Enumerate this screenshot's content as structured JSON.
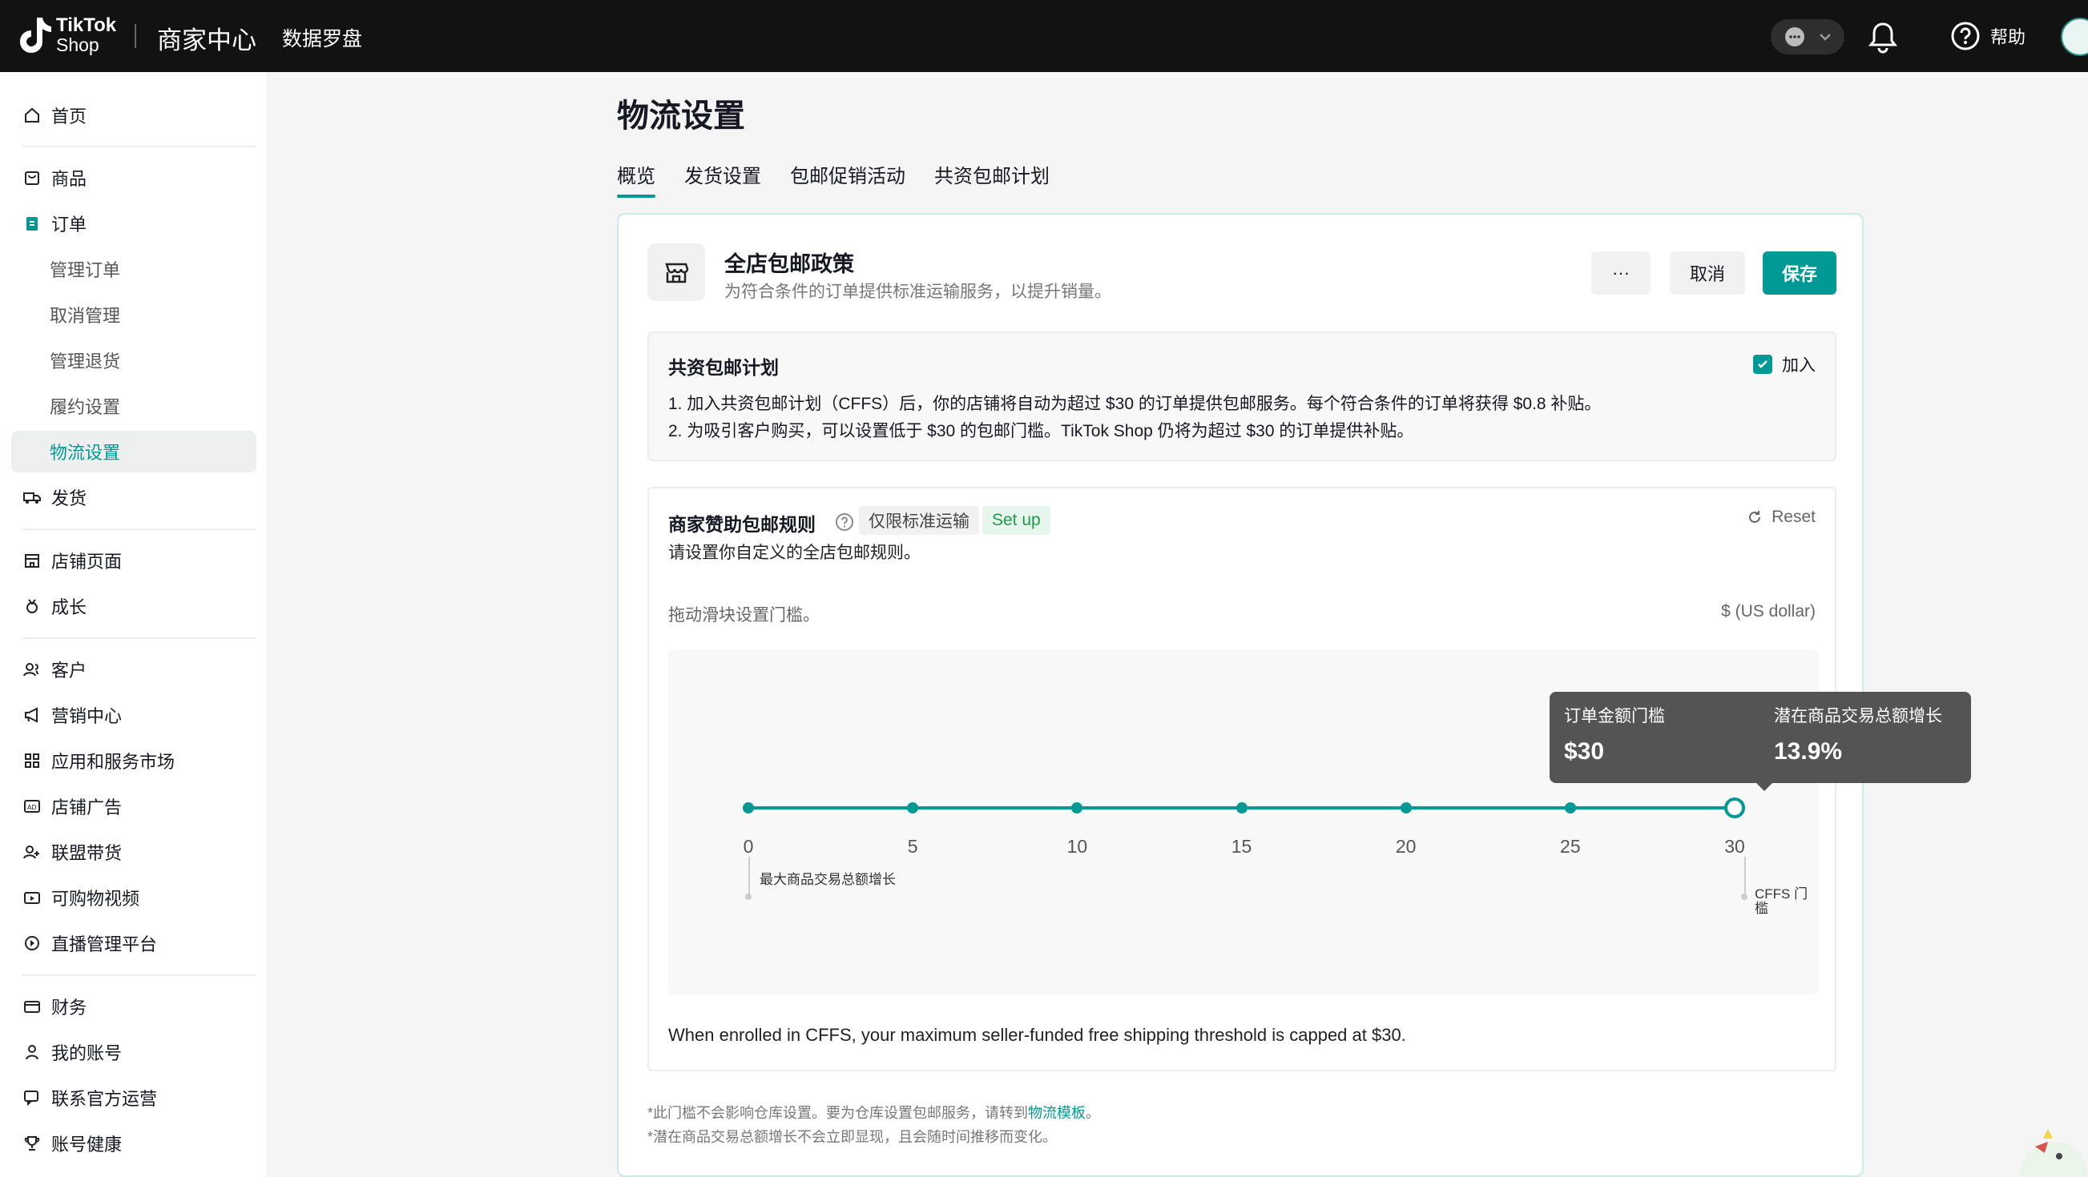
{
  "topbar": {
    "logo_line1": "TikTok",
    "logo_line2": "Shop",
    "brand": "商家中心",
    "compass": "数据罗盘",
    "help": "帮助",
    "chat_icon": "chat-bubble-icon",
    "bell_icon": "bell-icon",
    "help_icon": "question-circle-icon"
  },
  "sidebar": {
    "home": "首页",
    "products": "商品",
    "orders": "订单",
    "manage_orders": "管理订单",
    "cancel_mgmt": "取消管理",
    "manage_returns": "管理退货",
    "fulfillment": "履约设置",
    "logistics": "物流设置",
    "shipping": "发货",
    "store_page": "店铺页面",
    "growth": "成长",
    "customers": "客户",
    "marketing": "营销中心",
    "apps": "应用和服务市场",
    "ads": "店铺广告",
    "affiliate": "联盟带货",
    "shoppable_video": "可购物视频",
    "live": "直播管理平台",
    "finance": "财务",
    "account": "我的账号",
    "contact": "联系官方运营",
    "health": "账号健康"
  },
  "main": {
    "title": "物流设置",
    "tabs": [
      "概览",
      "发货设置",
      "包邮促销活动",
      "共资包邮计划"
    ]
  },
  "policy": {
    "title": "全店包邮政策",
    "subtitle": "为符合条件的订单提供标准运输服务，以提升销量。",
    "more_label": "···",
    "cancel_label": "取消",
    "save_label": "保存"
  },
  "cffs": {
    "title": "共资包邮计划",
    "join_label": "加入",
    "join_checked": true,
    "line1": "1. 加入共资包邮计划（CFFS）后，你的店铺将自动为超过 $30 的订单提供包邮服务。每个符合条件的订单将获得 $0.8 补贴。",
    "line2": "2. 为吸引客户购买，可以设置低于 $30 的包邮门槛。TikTok Shop 仍将为超过 $30 的订单提供补贴。"
  },
  "rule": {
    "title": "商家赞助包邮规则",
    "tag_standard": "仅限标准运输",
    "tag_setup": "Set up",
    "reset_label": "Reset",
    "subtitle": "请设置你自定义的全店包邮规则。",
    "drag_hint": "拖动滑块设置门槛。",
    "unit": "$ (US dollar)",
    "cap_note": "When enrolled in CFFS, your maximum seller-funded free shipping threshold is capped at $30."
  },
  "slider": {
    "min": 0,
    "max": 30,
    "value": 30,
    "ticks": [
      "0",
      "5",
      "10",
      "15",
      "20",
      "25",
      "30"
    ],
    "left_marker": "最大商品交易总额增长",
    "right_marker": "CFFS 门槛",
    "tooltip": {
      "threshold_label": "订单金额门槛",
      "threshold_value": "$30",
      "growth_label": "潜在商品交易总额增长",
      "growth_value": "13.9%"
    }
  },
  "footer": {
    "note1_prefix": "*此门槛不会影响仓库设置。要为仓库设置包邮服务，请转到",
    "note1_link": "物流模板",
    "note1_suffix": "。",
    "note2": "*潜在商品交易总额增长不会立即显现，且会随时间推移而变化。"
  },
  "colors": {
    "accent": "#009995",
    "topbar": "#121212",
    "setup_green": "#1f9a4a"
  }
}
